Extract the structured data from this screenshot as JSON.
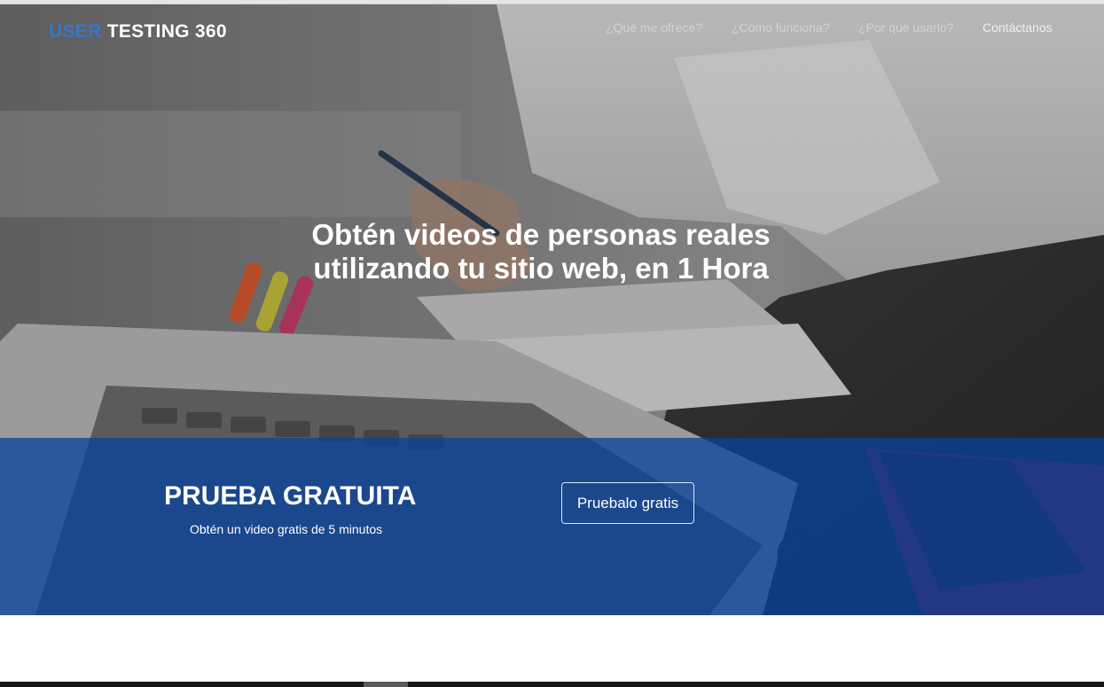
{
  "brand": {
    "part1": "USER",
    "part2": "TESTING 360",
    "part1_color": "#3a76c8"
  },
  "nav": {
    "items": [
      {
        "label": "¿Qué me ofrece?"
      },
      {
        "label": "¿Cómo funciona?"
      },
      {
        "label": "¿Por qué usarlo?"
      },
      {
        "label": "Contáctanos"
      }
    ]
  },
  "hero": {
    "line1": "Obtén videos de personas reales",
    "line2": "utilizando tu sitio web, en 1 Hora"
  },
  "promo": {
    "title": "PRUEBA GRATUITA",
    "subtitle": "Obtén un video gratis de 5 minutos",
    "button": "Pruebalo gratis",
    "band_color": "#0b3e92"
  }
}
